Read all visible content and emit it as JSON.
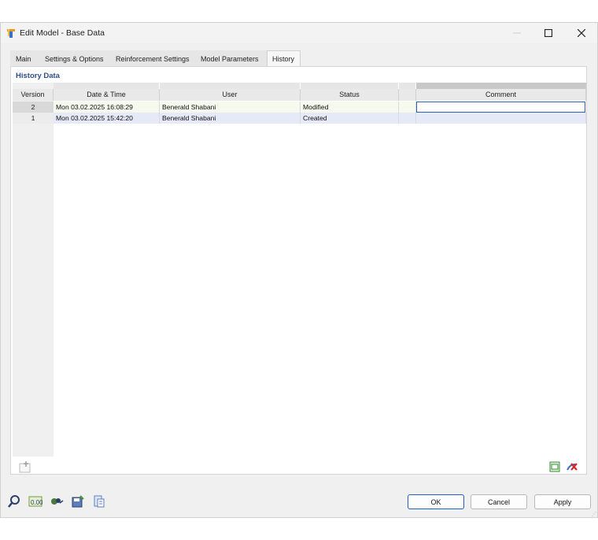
{
  "window": {
    "title": "Edit Model - Base Data"
  },
  "tabs": [
    {
      "label": "Main"
    },
    {
      "label": "Settings & Options"
    },
    {
      "label": "Reinforcement Settings"
    },
    {
      "label": "Model Parameters"
    },
    {
      "label": "History"
    }
  ],
  "section": {
    "title": "History Data"
  },
  "table": {
    "headers": {
      "version": "Version",
      "datetime": "Date & Time",
      "user": "User",
      "status": "Status",
      "comment": "Comment"
    },
    "rows": [
      {
        "version": "2",
        "datetime": "Mon 03.02.2025 16:08:29",
        "user": "Benerald Shabani",
        "status": "Modified",
        "comment": ""
      },
      {
        "version": "1",
        "datetime": "Mon 03.02.2025 15:42:20",
        "user": "Benerald Shabani",
        "status": "Created",
        "comment": ""
      }
    ]
  },
  "buttons": {
    "ok": "OK",
    "cancel": "Cancel",
    "apply": "Apply"
  },
  "icons": [
    "app-icon",
    "minimize-icon",
    "maximize-icon",
    "close-icon",
    "add-row-icon",
    "export-icon",
    "delete-icon",
    "search-icon",
    "decimal-icon",
    "units-icon",
    "save-icon",
    "info-icon"
  ],
  "colors": {
    "accent": "#1f5fbf",
    "title_text": "#2e4e8c",
    "row_modified": "#f6f9ee",
    "row_created": "#e6e9f8"
  }
}
